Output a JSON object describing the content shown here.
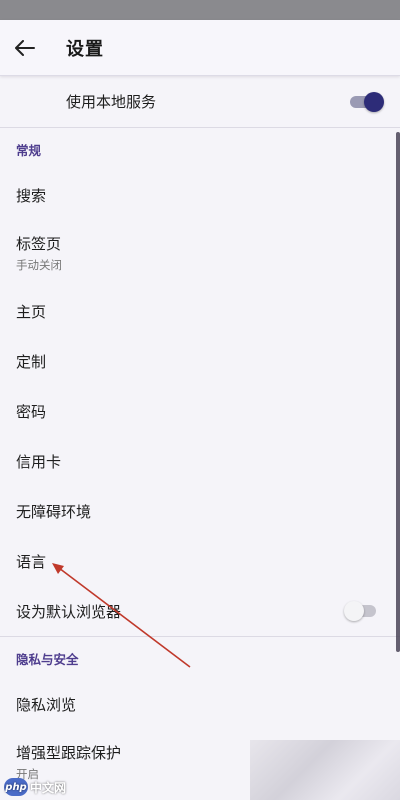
{
  "toolbar": {
    "title": "设置",
    "back_icon": "arrow-left-icon"
  },
  "local_service": {
    "label": "使用本地服务",
    "enabled": true
  },
  "sections": [
    {
      "header": "常规",
      "items": [
        {
          "title": "搜索"
        },
        {
          "title": "标签页",
          "subtitle": "手动关闭"
        },
        {
          "title": "主页"
        },
        {
          "title": "定制"
        },
        {
          "title": "密码"
        },
        {
          "title": "信用卡"
        },
        {
          "title": "无障碍环境"
        },
        {
          "title": "语言"
        },
        {
          "title": "设为默认浏览器",
          "toggle": false
        }
      ]
    },
    {
      "header": "隐私与安全",
      "items": [
        {
          "title": "隐私浏览"
        },
        {
          "title": "增强型跟踪保护",
          "subtitle": "开启"
        }
      ]
    }
  ],
  "watermark": {
    "logo_text": "php",
    "site_text": "中文网"
  },
  "colors": {
    "accent": "#2d2c78",
    "section_header": "#4e3d8e",
    "annotation_arrow": "#c0392b"
  }
}
